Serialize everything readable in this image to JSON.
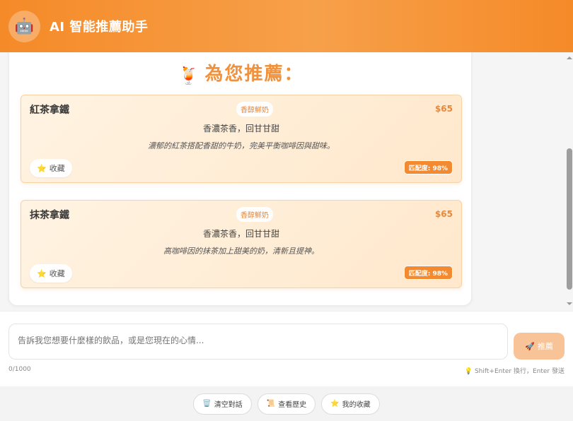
{
  "header": {
    "avatar_icon": "🤖",
    "title": "AI 智能推薦助手"
  },
  "recommendation": {
    "heading_emoji": "🍹",
    "heading": "為您推薦：",
    "cards": [
      {
        "name": "紅茶拿鐵",
        "tag": "香醇鮮奶",
        "price": "$65",
        "desc1": "香濃茶香，回甘甘甜",
        "desc2": "濃郁的紅茶搭配香甜的牛奶，完美平衡咖啡因與甜味。",
        "fav_icon": "⭐",
        "fav_label": "收藏",
        "match": "匹配度: 98%"
      },
      {
        "name": "抹茶拿鐵",
        "tag": "香醇鮮奶",
        "price": "$65",
        "desc1": "香濃茶香，回甘甘甜",
        "desc2": "高咖啡因的抹茶加上甜美的奶，清新且提神。",
        "fav_icon": "⭐",
        "fav_label": "收藏",
        "match": "匹配度: 98%"
      }
    ]
  },
  "input": {
    "placeholder": "告訴我您想要什麼樣的飲品，或是您現在的心情...",
    "value": "",
    "send_icon": "🚀",
    "send_label": "推薦",
    "char_count": "0/1000",
    "hint_icon": "💡",
    "hint": "Shift+Enter 換行，Enter 發送"
  },
  "footer": {
    "buttons": [
      {
        "icon": "🗑️",
        "label": "清空對話"
      },
      {
        "icon": "📜",
        "label": "查看歷史"
      },
      {
        "icon": "⭐",
        "label": "我的收藏"
      }
    ]
  },
  "colors": {
    "accent": "#f58a28",
    "accent_light": "#f8c497",
    "title_orange": "#f0923d"
  }
}
